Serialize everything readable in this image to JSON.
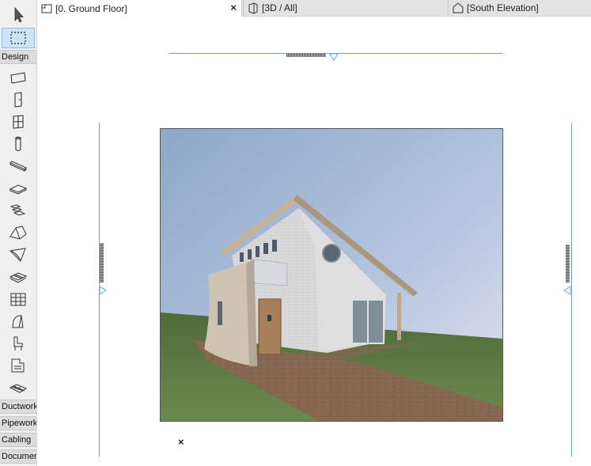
{
  "tabs": [
    {
      "label": "[0. Ground Floor]",
      "icon": "floor-plan-icon",
      "active": true,
      "close": "×"
    },
    {
      "label": "[3D / All]",
      "icon": "3d-window-icon",
      "active": false
    },
    {
      "label": "[South Elevation]",
      "icon": "elevation-icon",
      "active": false
    }
  ],
  "toolbox": {
    "top_tools": [
      {
        "name": "arrow-tool",
        "icon": "arrow-pointer-icon"
      },
      {
        "name": "marquee-tool",
        "icon": "marquee-icon",
        "selected": true
      }
    ],
    "groups": [
      {
        "label": "Design",
        "collapsed": false
      },
      {
        "label": "Ductwork",
        "collapsed": true
      },
      {
        "label": "Pipework",
        "collapsed": true
      },
      {
        "label": "Cabling",
        "collapsed": true
      },
      {
        "label": "Document",
        "collapsed": true
      }
    ],
    "design_tools": [
      "wall-tool",
      "door-tool",
      "window-tool",
      "column-tool",
      "beam-tool",
      "slab-tool",
      "stair-tool",
      "roof-tool",
      "shell-tool",
      "mesh-tool",
      "curtain-wall-tool",
      "morph-tool",
      "object-tool",
      "zone-tool",
      "railing-tool"
    ]
  },
  "canvas": {
    "origin_mark": "×",
    "colors": {
      "marker_line": "#6aa7d6",
      "frame_border": "#555555"
    }
  }
}
